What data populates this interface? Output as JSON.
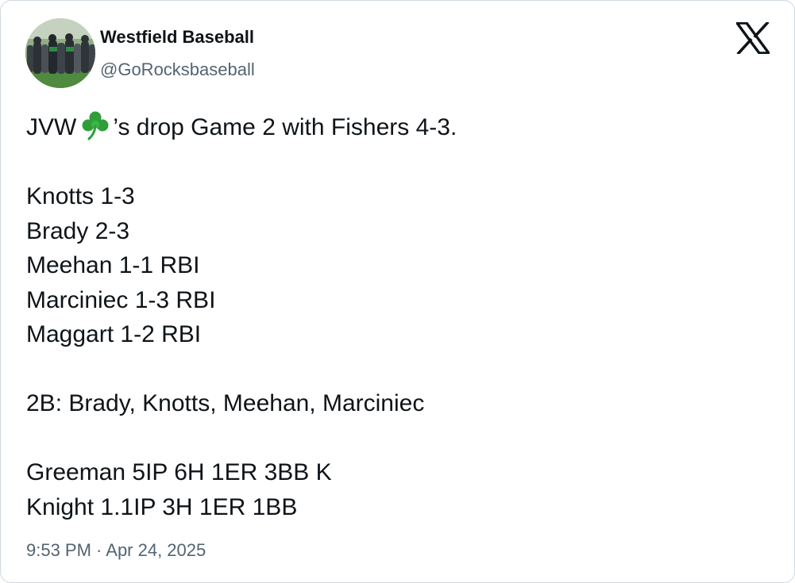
{
  "tweet": {
    "author_name": "Westfield Baseball",
    "author_handle": "@GoRocksbaseball",
    "text_line1_before": "JVW",
    "emoji": "shamrock-icon",
    "text_line1_after": "’s drop Game 2 with Fishers 4-3.",
    "stats": [
      "Knotts 1-3",
      "Brady 2-3",
      "Meehan 1-1 RBI",
      "Marciniec 1-3 RBI",
      "Maggart 1-2 RBI"
    ],
    "doubles": "2B: Brady, Knotts, Meehan, Marciniec",
    "pitching": [
      "Greeman 5IP 6H 1ER 3BB K",
      "Knight 1.1IP 3H 1ER 1BB"
    ],
    "timestamp": "9:53 PM · Apr 24, 2025"
  },
  "colors": {
    "text": "#0f1419",
    "secondary": "#536471",
    "border": "#cfd9de",
    "shamrock": "#2f9e3a"
  }
}
